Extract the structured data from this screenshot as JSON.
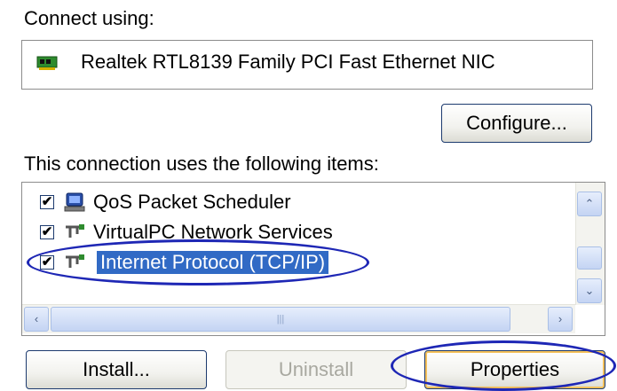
{
  "connect_label": "Connect using:",
  "adapter": {
    "name": "Realtek RTL8139 Family PCI Fast Ethernet NIC",
    "icon": "network-card-icon"
  },
  "configure_button": "Configure...",
  "items_label": "This connection uses the following items:",
  "items": [
    {
      "label": "QoS Packet Scheduler",
      "checked": true,
      "icon": "scheduler-icon",
      "selected": false
    },
    {
      "label": "VirtualPC Network Services",
      "checked": true,
      "icon": "network-protocol-icon",
      "selected": false
    },
    {
      "label": "Internet Protocol (TCP/IP)",
      "checked": true,
      "icon": "network-protocol-icon",
      "selected": true
    }
  ],
  "buttons": {
    "install": "Install...",
    "uninstall": "Uninstall",
    "properties": "Properties"
  },
  "colors": {
    "selection": "#316ac5",
    "highlight_ellipse": "#1e27b5"
  }
}
